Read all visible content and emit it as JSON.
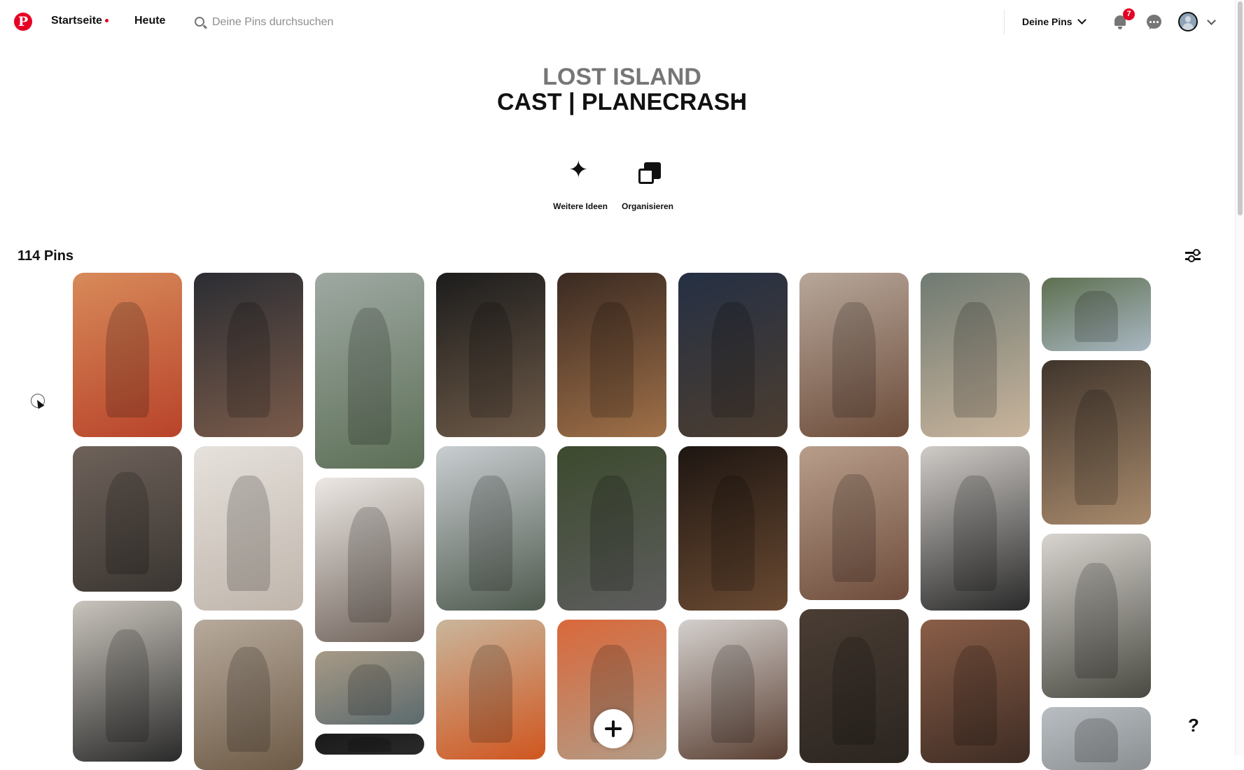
{
  "header": {
    "home_label": "Startseite",
    "today_label": "Heute",
    "search_placeholder": "Deine Pins durchsuchen",
    "your_pins_label": "Deine Pins",
    "notification_count": "7"
  },
  "board": {
    "supertitle": "LOST ISLAND",
    "title": "CAST | PLANECRASH",
    "more_label": "···"
  },
  "actions": {
    "more_ideas_label": "Weitere Ideen",
    "organize_label": "Organisieren"
  },
  "pins_section": {
    "count_label": "114 Pins"
  },
  "help_label": "?",
  "colors": {
    "brand_red": "#e60023",
    "text_primary": "#111111",
    "text_muted": "#767676"
  },
  "pins": [
    {
      "column": 1,
      "subject": "woman-red-curly-hair",
      "colors": [
        "#d88a5a",
        "#b8432a"
      ]
    },
    {
      "column": 1,
      "subject": "woman-denim-jacket-street",
      "colors": [
        "#6e625a",
        "#3b3632"
      ]
    },
    {
      "column": 1,
      "subject": "young-man-black-hoodie",
      "colors": [
        "#c9c4bc",
        "#2a2a2a"
      ]
    },
    {
      "column": 2,
      "subject": "man-glasses-neon-city",
      "colors": [
        "#2b2d33",
        "#7a5b4a"
      ]
    },
    {
      "column": 2,
      "subject": "woman-white-dress-window",
      "colors": [
        "#e6e1dc",
        "#bfb5ab"
      ]
    },
    {
      "column": 2,
      "subject": "man-camel-coat-phone",
      "colors": [
        "#b7aa9c",
        "#6d5a46"
      ]
    },
    {
      "column": 3,
      "subject": "woman-skateboard-street",
      "colors": [
        "#9fa9a3",
        "#5c6f56"
      ]
    },
    {
      "column": 3,
      "subject": "woman-chair-window",
      "colors": [
        "#ece8e4",
        "#6f625a"
      ]
    },
    {
      "column": 3,
      "subject": "man-sunglasses-street",
      "colors": [
        "#a89a86",
        "#5b6a6e"
      ]
    },
    {
      "column": 3,
      "subject": "dark-image",
      "colors": [
        "#1a1a1a",
        "#2a2a2a"
      ]
    },
    {
      "column": 4,
      "subject": "curly-man-drink",
      "colors": [
        "#1c1c1c",
        "#6e5a48"
      ]
    },
    {
      "column": 4,
      "subject": "man-car-gas-station",
      "colors": [
        "#c9ced1",
        "#4f5a4e"
      ]
    },
    {
      "column": 4,
      "subject": "woman-hijab-orange",
      "colors": [
        "#c9b69c",
        "#d0561f"
      ]
    },
    {
      "column": 5,
      "subject": "woman-short-hair-vest",
      "colors": [
        "#3a2a22",
        "#a07048"
      ]
    },
    {
      "column": 5,
      "subject": "man-basketball-park",
      "colors": [
        "#3c4a2e",
        "#5d5d5d"
      ]
    },
    {
      "column": 5,
      "subject": "man-orange-beanie",
      "colors": [
        "#d9683a",
        "#b39b86"
      ]
    },
    {
      "column": 6,
      "subject": "man-suit-newspaper",
      "colors": [
        "#253044",
        "#4c3d30"
      ]
    },
    {
      "column": 6,
      "subject": "man-beard-brown-jacket",
      "colors": [
        "#1e1612",
        "#6a4a32"
      ]
    },
    {
      "column": 6,
      "subject": "woman-curly-portrait",
      "colors": [
        "#d4d0cd",
        "#5a3f32"
      ]
    },
    {
      "column": 7,
      "subject": "woman-trench-coat-stairs",
      "colors": [
        "#b7a79a",
        "#6d4c3a"
      ]
    },
    {
      "column": 7,
      "subject": "man-shirtless-suspenders",
      "colors": [
        "#b89e8a",
        "#6e4c3c"
      ]
    },
    {
      "column": 7,
      "subject": "man-glasses-reading",
      "colors": [
        "#4a3d34",
        "#2b2520"
      ]
    },
    {
      "column": 8,
      "subject": "man-floral-shirt",
      "colors": [
        "#6f7a72",
        "#c9b49c"
      ]
    },
    {
      "column": 8,
      "subject": "man-prosthetic-leg-chair",
      "colors": [
        "#cfcbc7",
        "#2a2a2a"
      ]
    },
    {
      "column": 8,
      "subject": "woman-ponytail-sofa",
      "colors": [
        "#8a5e48",
        "#3e2c24"
      ]
    },
    {
      "column": 9,
      "subject": "person-garden",
      "colors": [
        "#5e7050",
        "#a9b7c2"
      ]
    },
    {
      "column": 9,
      "subject": "woman-braids-portrait",
      "colors": [
        "#40352c",
        "#a88a6c"
      ]
    },
    {
      "column": 9,
      "subject": "older-woman-chair",
      "colors": [
        "#d8d4cf",
        "#4a4a42"
      ]
    },
    {
      "column": 9,
      "subject": "street-building",
      "colors": [
        "#b9bec2",
        "#8a8f92"
      ]
    }
  ]
}
